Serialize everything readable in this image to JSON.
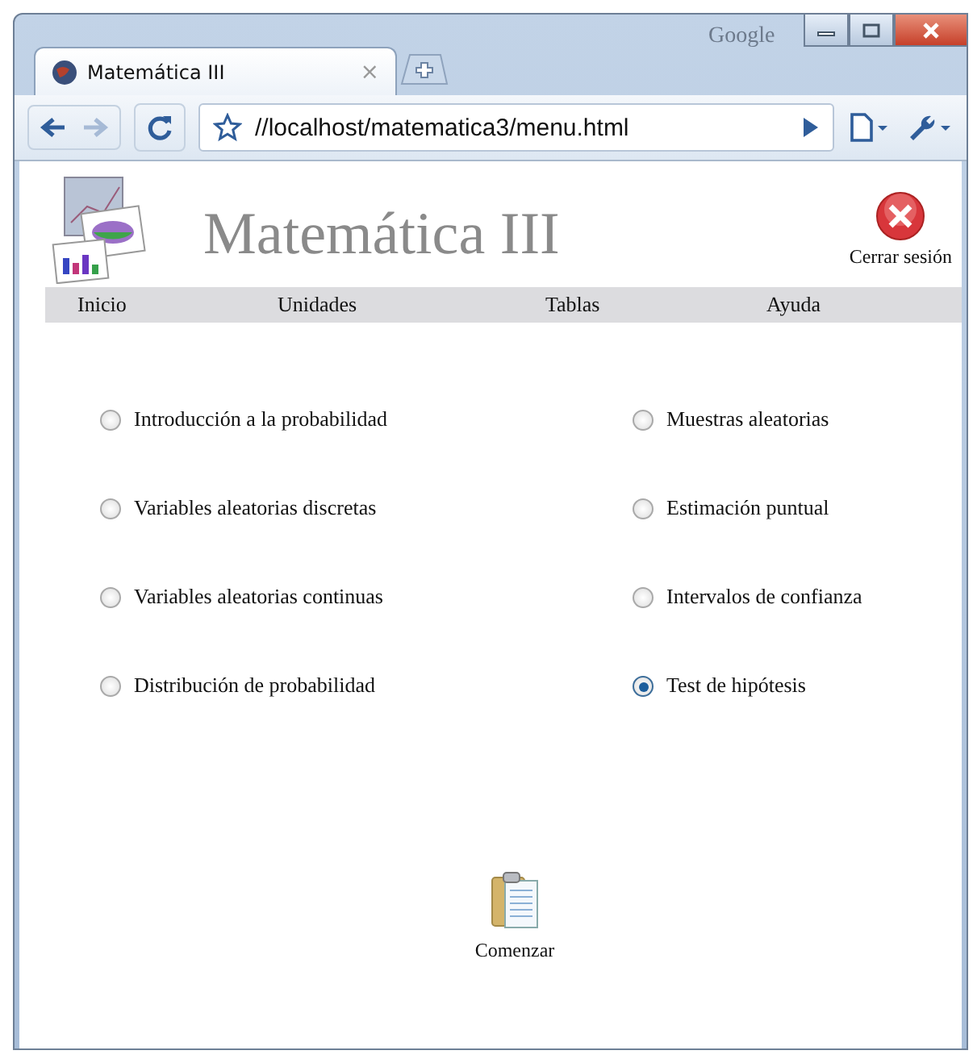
{
  "browser": {
    "brand": "Google",
    "tab": {
      "title": "Matemática III",
      "close": "×"
    },
    "url": "//localhost/matematica3/menu.html"
  },
  "header": {
    "title": "Matemática III",
    "logout": "Cerrar sesión"
  },
  "nav": [
    "Inicio",
    "Unidades",
    "Tablas",
    "Ayuda"
  ],
  "options": [
    {
      "label": "Introducción a la probabilidad",
      "selected": false
    },
    {
      "label": "Variables aleatorias discretas",
      "selected": false
    },
    {
      "label": "Variables aleatorias continuas",
      "selected": false
    },
    {
      "label": "Distribución de probabilidad",
      "selected": false
    },
    {
      "label": "Muestras aleatorias",
      "selected": false
    },
    {
      "label": "Estimación puntual",
      "selected": false
    },
    {
      "label": "Intervalos de confianza",
      "selected": false
    },
    {
      "label": "Test de hipótesis",
      "selected": true
    }
  ],
  "start_button": "Comenzar"
}
